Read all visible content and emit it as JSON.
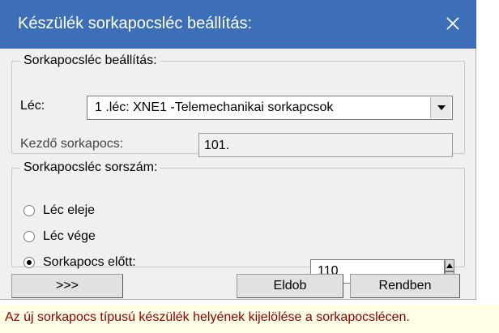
{
  "dialog": {
    "title": "Készülék sorkapocsléc beállítás:",
    "close_icon": "close-icon",
    "titlebar_color": "#3d6fb8"
  },
  "terminal_strip_settings": {
    "legend": "Sorkapocsléc beállítás:",
    "strip_label": "Léc:",
    "strip_selected": "1 .léc:  XNE1 -Telemechanikai sorkapcsok",
    "start_terminal_label": "Kezdő sorkapocs:",
    "start_terminal_value": "101."
  },
  "terminal_strip_order": {
    "legend": "Sorkapocsléc sorszám:",
    "options": [
      {
        "label": "Léc eleje",
        "selected": false
      },
      {
        "label": "Léc vége",
        "selected": false
      },
      {
        "label": "Sorkapocs előtt:",
        "selected": true
      }
    ],
    "before_terminal_value": "110"
  },
  "buttons": {
    "more": ">>>",
    "cancel": "Eldob",
    "ok": "Rendben"
  },
  "status_bar": {
    "message": "Az új sorkapocs típusú készülék helyének kijelölése a sorkapocslécen.",
    "text_color": "#8b0000",
    "background": "#fffde6"
  }
}
